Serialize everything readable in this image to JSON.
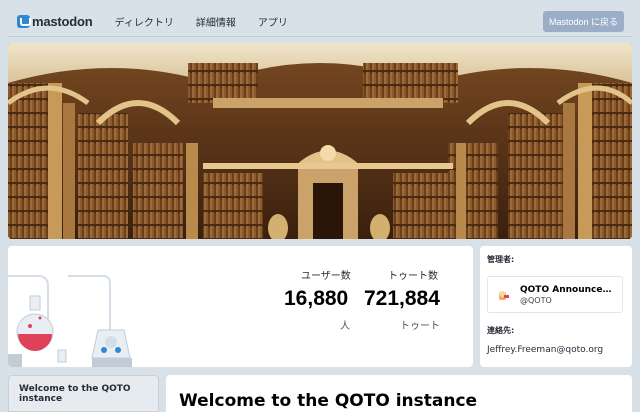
{
  "nav": {
    "brand": "mastodon",
    "links": [
      "ディレクトリ",
      "詳細情報",
      "アプリ"
    ],
    "back_button": "Mastodon に戻る"
  },
  "stats": {
    "users_label": "ユーザー数",
    "users_value": "16,880",
    "users_unit": "人",
    "toots_label": "トゥート数",
    "toots_value": "721,884",
    "toots_unit": "トゥート"
  },
  "admin": {
    "heading": "管理者:",
    "account_name": "QOTO Announcements...",
    "account_handle": "@QOTO",
    "contact_heading": "連絡先:",
    "contact_email": "Jeffrey.Freeman@qoto.org"
  },
  "sidebar": {
    "tab_label": "Welcome to the QOTO instance"
  },
  "main": {
    "title": "Welcome to the QOTO instance"
  },
  "colors": {
    "accent": "#3088d4",
    "button_bg": "#9baec8",
    "page_bg": "#d9e1e8"
  }
}
